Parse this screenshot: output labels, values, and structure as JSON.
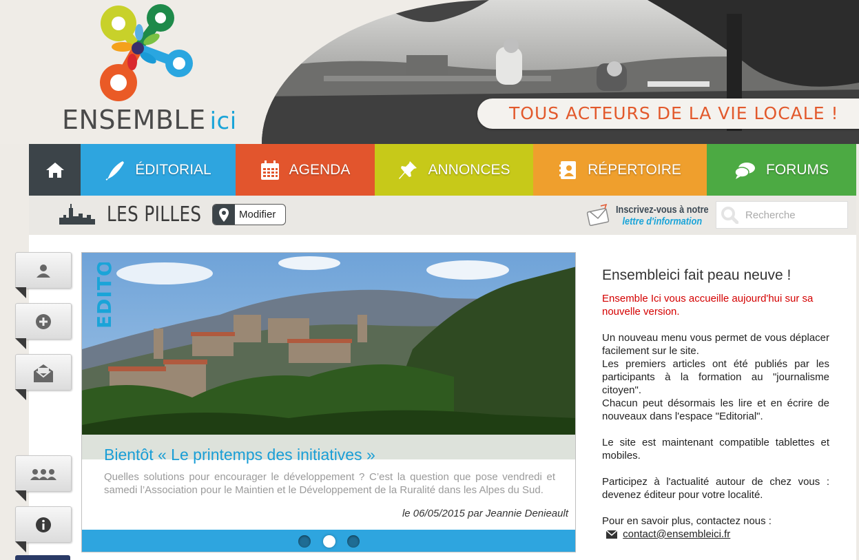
{
  "header": {
    "logo_main": "ENSEMBLE",
    "logo_accent": "ici",
    "tagline": "TOUS ACTEURS DE LA VIE LOCALE !"
  },
  "nav": {
    "home_icon": "home-icon",
    "items": [
      {
        "label": "ÉDITORIAL",
        "icon": "pen-icon",
        "color": "#2ea5df"
      },
      {
        "label": "AGENDA",
        "icon": "calendar-icon",
        "color": "#e2552d"
      },
      {
        "label": "ANNONCES",
        "icon": "pushpin-icon",
        "color": "#c7c919"
      },
      {
        "label": "RÉPERTOIRE",
        "icon": "address-book-icon",
        "color": "#ef9f2d"
      },
      {
        "label": "FORUMS",
        "icon": "chat-icon",
        "color": "#4caa43"
      }
    ]
  },
  "subbar": {
    "town": "LES PILLES",
    "modify_label": "Modifier",
    "newsletter_line1": "Inscrivez-vous à notre",
    "newsletter_line2": "lettre d'information",
    "search_placeholder": "Recherche"
  },
  "sidebar": {
    "tabs": [
      "user-icon",
      "add-icon",
      "envelope-icon",
      "group-icon",
      "info-icon"
    ]
  },
  "slider": {
    "badge": "EDITO",
    "title": "Bientôt « Le printemps des initiatives »",
    "excerpt": "Quelles solutions pour encourager le développement ? C’est la question que pose vendredi et samedi l’Association pour le Maintien et le Développement de la Ruralité dans les Alpes du Sud.",
    "meta": "le 06/05/2015 par Jeannie Denieault",
    "slide_count": 3,
    "active_slide": 2
  },
  "article": {
    "title": "Ensembleici fait peau neuve !",
    "intro": "Ensemble Ici vous accueille aujourd'hui sur sa nouvelle version.",
    "p1": "Un nouveau menu vous permet de vous déplacer facilement sur le site.",
    "p2": "Les premiers articles ont été publiés par les participants à la formation au \"journalisme citoyen\".",
    "p3": "Chacun peut désormais les lire et en écrire de nouveaux dans l'espace \"Editorial\".",
    "p4": "Le site est maintenant compatible tablettes et mobiles.",
    "p5": "Participez à l'actualité autour de chez vous : devenez éditeur pour votre localité.",
    "contact_text": "Pour en savoir plus, contactez nous :",
    "contact_email": "contact@ensembleici.fr"
  }
}
